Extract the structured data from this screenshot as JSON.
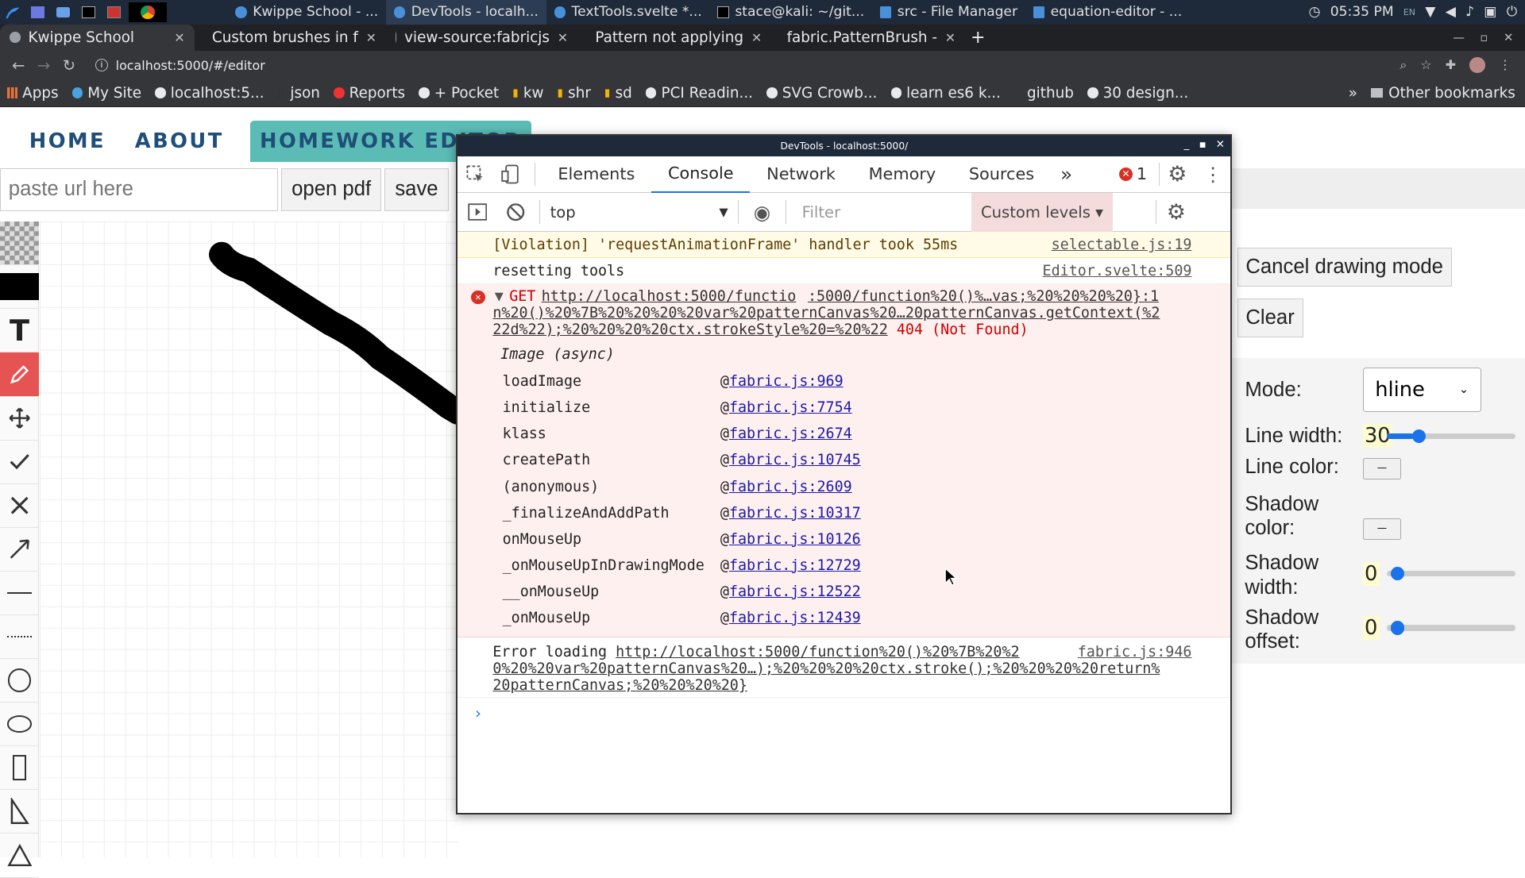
{
  "taskbar": {
    "tasks": [
      {
        "label": "Kwippe School - ..."
      },
      {
        "label": "DevTools - localh..."
      },
      {
        "label": "TextTools.svelte *..."
      },
      {
        "label": "stace@kali: ~/git..."
      },
      {
        "label": "src - File Manager"
      },
      {
        "label": "equation-editor - ..."
      }
    ],
    "time": "05:35 PM",
    "lang": "EN"
  },
  "tabs": [
    {
      "label": "Kwippe School"
    },
    {
      "label": "Custom brushes in f"
    },
    {
      "label": "view-source:fabricjs"
    },
    {
      "label": "Pattern not applying"
    },
    {
      "label": "fabric.PatternBrush -"
    }
  ],
  "address": {
    "url": "localhost:5000/#/editor"
  },
  "bookmarks": [
    {
      "label": "Apps"
    },
    {
      "label": "My Site"
    },
    {
      "label": "localhost:5..."
    },
    {
      "label": "json",
      "prefix": "JF"
    },
    {
      "label": "Reports"
    },
    {
      "label": "+ Pocket"
    },
    {
      "label": "kw"
    },
    {
      "label": "shr"
    },
    {
      "label": "sd"
    },
    {
      "label": "PCI Readin..."
    },
    {
      "label": "SVG Crowb..."
    },
    {
      "label": "learn es6 k..."
    },
    {
      "label": "github"
    },
    {
      "label": "30 design..."
    }
  ],
  "other_bookmarks": "Other bookmarks",
  "app": {
    "nav": {
      "home": "HOME",
      "about": "ABOUT",
      "editor": "HOMEWORK EDITOR"
    },
    "url_placeholder": "paste url here",
    "open_pdf": "open pdf",
    "save": "save",
    "cancel_drawing": "Cancel drawing mode",
    "clear": "Clear",
    "props": {
      "mode_label": "Mode:",
      "mode_value": "hline",
      "line_width_label": "Line width:",
      "line_width_value": "30",
      "line_color_label": "Line color:",
      "shadow_color_label1": "Shadow",
      "shadow_color_label2": "color:",
      "shadow_width_label1": "Shadow",
      "shadow_width_label2": "width:",
      "shadow_width_value": "0",
      "shadow_offset_label1": "Shadow",
      "shadow_offset_label2": "offset:",
      "shadow_offset_value": "0"
    },
    "tools": [
      "checker-pattern",
      "color-swatch",
      "text-tool",
      "pencil-tool",
      "move-tool",
      "check-tool",
      "close-tool",
      "arrow-tool",
      "line-tool",
      "dotted-line-tool",
      "circle-tool",
      "ellipse-tool",
      "rectangle-tool",
      "right-triangle-tool",
      "triangle-tool"
    ]
  },
  "devtools": {
    "title": "DevTools - localhost:5000/",
    "tabs": [
      "Elements",
      "Console",
      "Network",
      "Memory",
      "Sources"
    ],
    "more": "»",
    "error_count": "1",
    "context": "top",
    "filter_placeholder": "Filter",
    "levels": "Custom levels ▾",
    "console": {
      "violation": {
        "text": "[Violation] 'requestAnimationFrame' handler took 55ms",
        "src": "selectable.js:19"
      },
      "resetting": {
        "text": "resetting tools",
        "src": "Editor.svelte:509"
      },
      "get_error": {
        "method": "GET",
        "url1": "http://localhost:5000/functio",
        "url_short": ":5000/function%20()%…vas;%20%20%20%20}:1",
        "url2": "n%20()%20%7B%20%20%20%20var%20patternCanvas%20…20patternCanvas.getContext(%2",
        "url3": "22d%22);%20%20%20%20ctx.strokeStyle%20=%20%22",
        "status": "404 (Not Found)",
        "async_label": "Image (async)"
      },
      "stack": [
        {
          "fn": "loadImage",
          "src": "fabric.js:969"
        },
        {
          "fn": "initialize",
          "src": "fabric.js:7754"
        },
        {
          "fn": "klass",
          "src": "fabric.js:2674"
        },
        {
          "fn": "createPath",
          "src": "fabric.js:10745"
        },
        {
          "fn": "(anonymous)",
          "src": "fabric.js:2609"
        },
        {
          "fn": "_finalizeAndAddPath",
          "src": "fabric.js:10317"
        },
        {
          "fn": "onMouseUp",
          "src": "fabric.js:10126"
        },
        {
          "fn": "_onMouseUpInDrawingMode",
          "src": "fabric.js:12729"
        },
        {
          "fn": "__onMouseUp",
          "src": "fabric.js:12522"
        },
        {
          "fn": "_onMouseUp",
          "src": "fabric.js:12439"
        }
      ],
      "loading_error": {
        "prefix": "Error loading",
        "url1": "http://localhost:5000/function%20()%20%7B%20%2",
        "src": "fabric.js:946",
        "url2": "0%20%20var%20patternCanvas%20…);%20%20%20%20ctx.stroke();%20%20%20%20return%",
        "url3": "20patternCanvas;%20%20%20%20}"
      },
      "prompt": "›"
    }
  },
  "colors": {
    "accent": "#5bbcb5",
    "nav_text": "#1f4e79",
    "tool_selected": "#e65353",
    "devtools_active": "#1a73e8",
    "error_red": "#cc0000"
  }
}
